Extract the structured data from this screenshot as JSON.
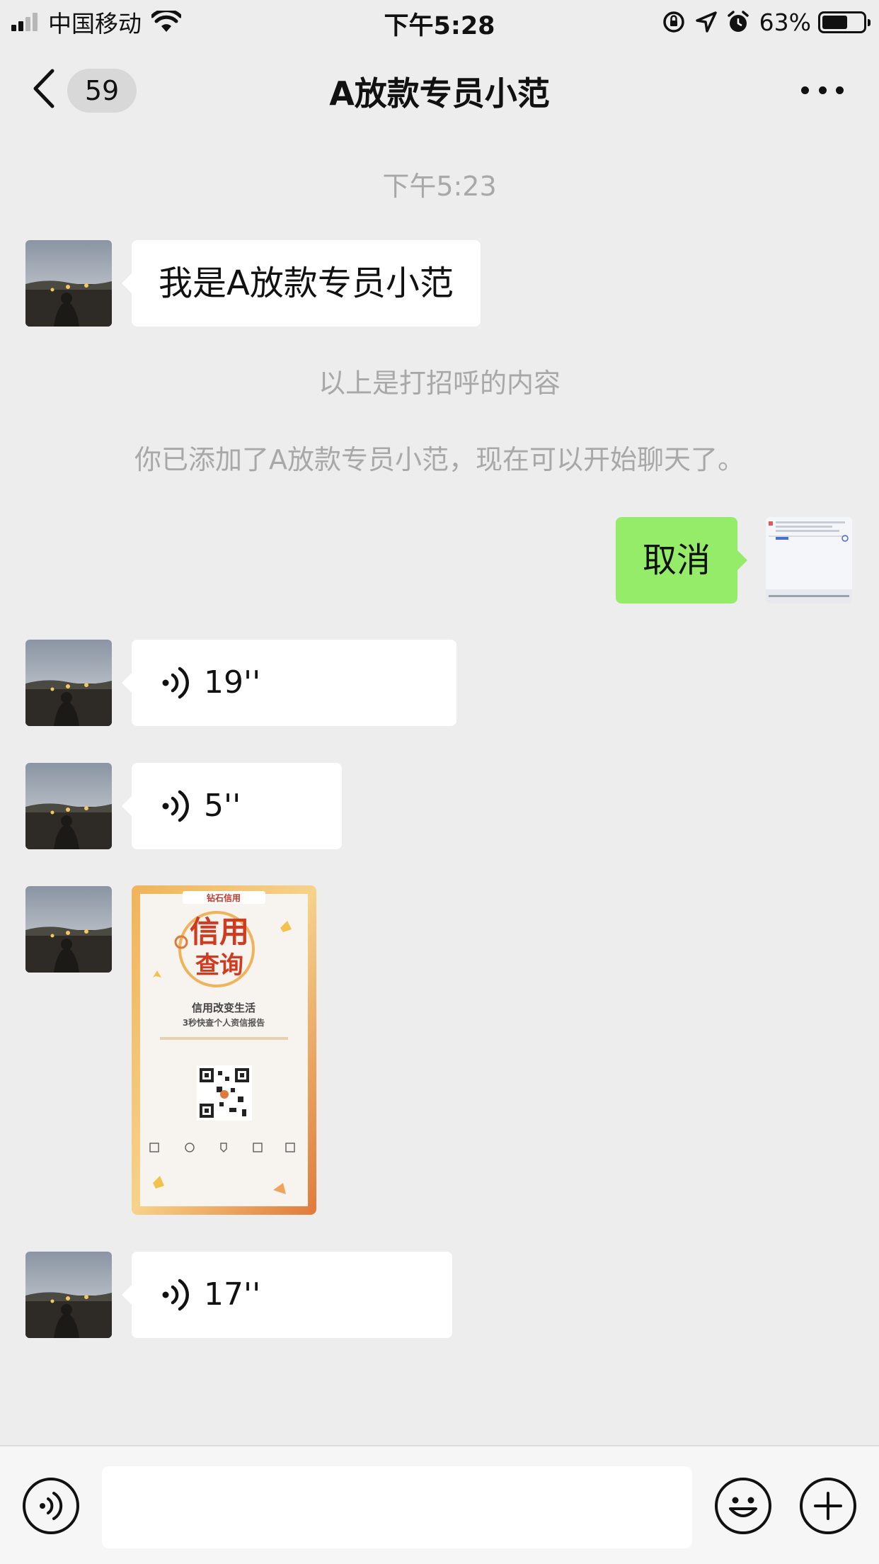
{
  "status_bar": {
    "carrier": "中国移动",
    "time": "下午5:28",
    "battery_percent": "63%",
    "battery_level": 0.63,
    "icons": [
      "signal-icon",
      "wifi-icon",
      "orientation-lock-icon",
      "location-icon",
      "alarm-icon",
      "battery-icon"
    ]
  },
  "nav": {
    "unread_count": "59",
    "title": "A放款专员小范",
    "back_icon": "chevron-left-icon",
    "more_icon": "more-dots-icon"
  },
  "chat": {
    "timestamp": "下午5:23",
    "greeting_message": "我是A放款专员小范",
    "system_note_1": "以上是打招呼的内容",
    "system_note_2": "你已添加了A放款专员小范，现在可以开始聊天了。",
    "my_message": "取消",
    "voice_messages": [
      {
        "duration": "19''"
      },
      {
        "duration": "5''"
      },
      {
        "duration": "17''"
      }
    ],
    "poster_image": {
      "brand": "钻石信用",
      "headline_1": "信用",
      "headline_2": "查询",
      "subtitle": "信用改变生活",
      "tagline": "3秒快查个人资信报告"
    }
  },
  "input_bar": {
    "voice_icon": "voice-input-icon",
    "emoji_icon": "emoji-icon",
    "plus_icon": "plus-icon",
    "input_value": ""
  },
  "colors": {
    "background": "#ededed",
    "incoming_bubble": "#ffffff",
    "outgoing_bubble": "#95ec69",
    "system_text": "#a8a8a8"
  }
}
